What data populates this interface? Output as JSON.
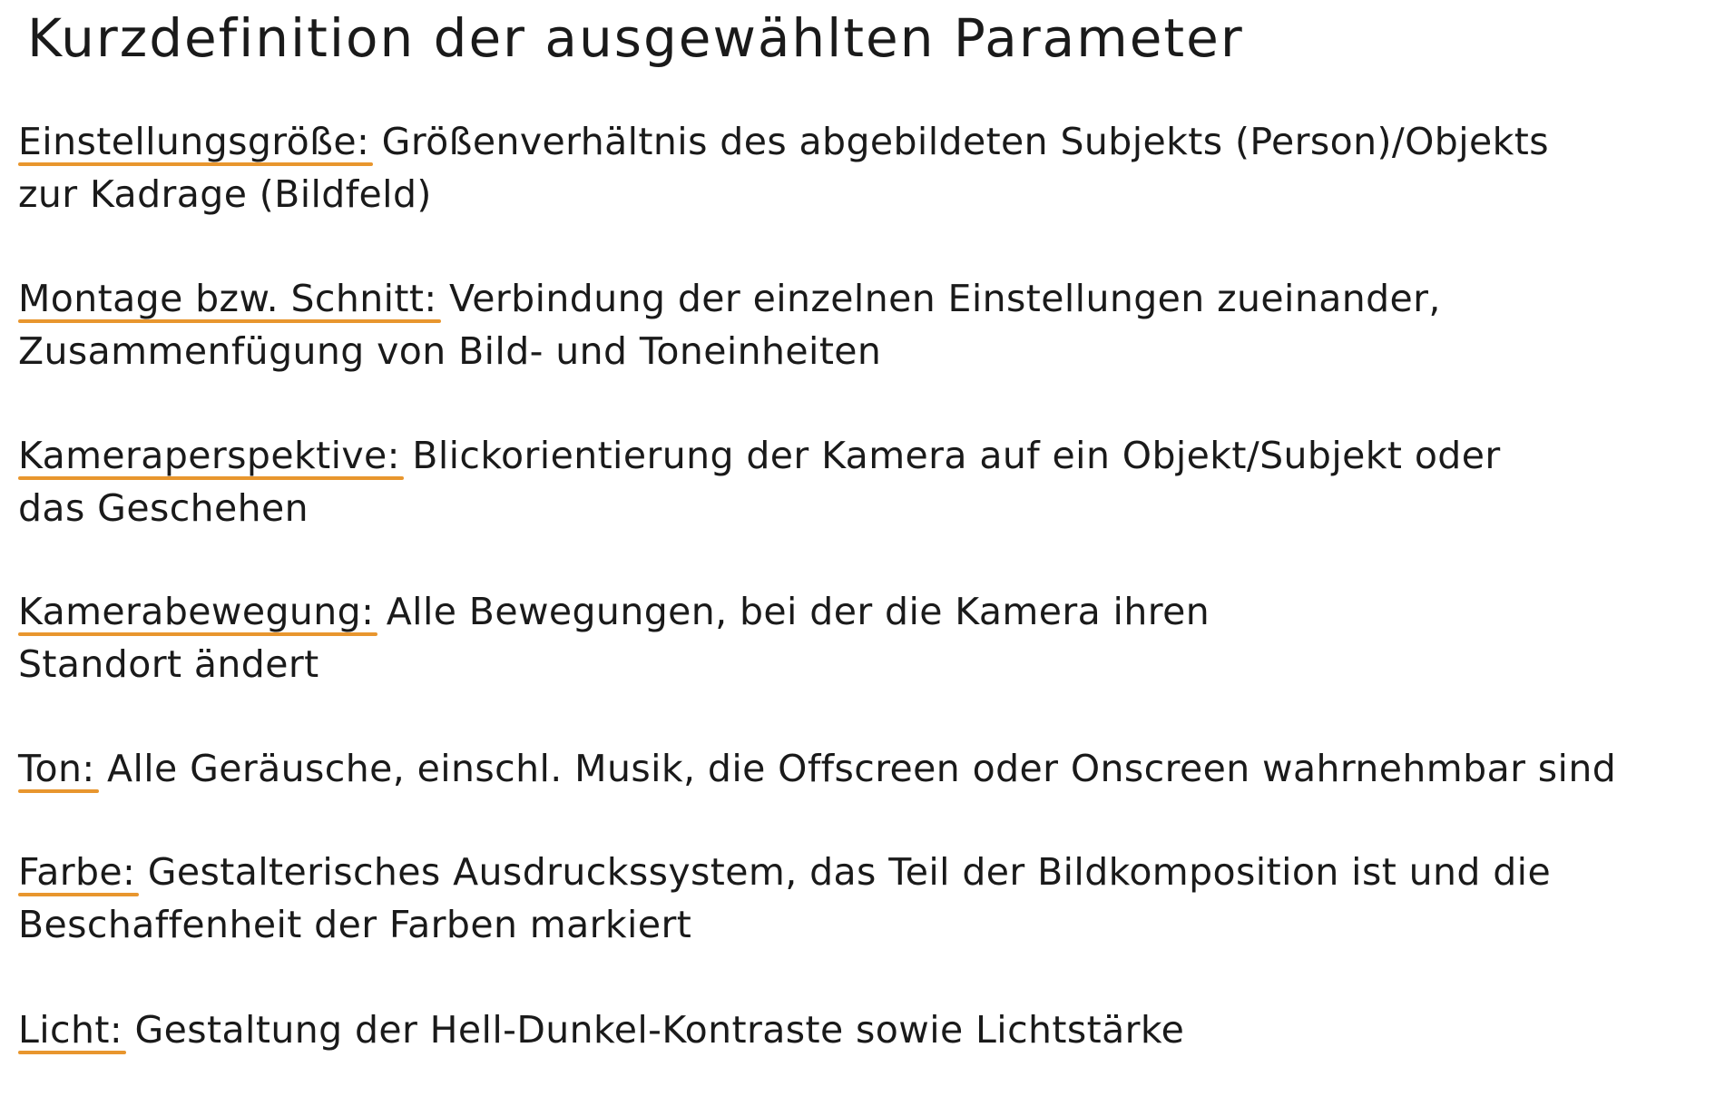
{
  "title": "Kurzdefinition der ausgewählten Parameter",
  "accent_color": "#e8962e",
  "definitions": [
    {
      "term": "Einstellungsgröße:",
      "text_line1": " Größenverhältnis des abgebildeten Subjekts (Person)/Objekts",
      "text_line2": "zur Kadrage (Bildfeld)"
    },
    {
      "term": "Montage bzw. Schnitt:",
      "text_line1": " Verbindung der einzelnen Einstellungen zueinander,",
      "text_line2": "Zusammenfügung von Bild- und Toneinheiten"
    },
    {
      "term": "Kameraperspektive:",
      "text_line1": " Blickorientierung der Kamera auf ein Objekt/Subjekt oder",
      "text_line2": "das Geschehen"
    },
    {
      "term": "Kamerabewegung:",
      "text_line1": " Alle Bewegungen, bei der die Kamera ihren",
      "text_line2": "Standort ändert"
    },
    {
      "term": "Ton:",
      "text_line1": " Alle Geräusche, einschl. Musik, die Offscreen oder Onscreen wahrnehmbar sind"
    },
    {
      "term": "Farbe:",
      "text_line1": " Gestalterisches Ausdruckssystem, das Teil der Bildkomposition ist und die",
      "text_line2": "Beschaffenheit der Farben markiert"
    },
    {
      "term": "Licht:",
      "text_line1": " Gestaltung der Hell-Dunkel-Kontraste sowie Lichtstärke"
    }
  ]
}
